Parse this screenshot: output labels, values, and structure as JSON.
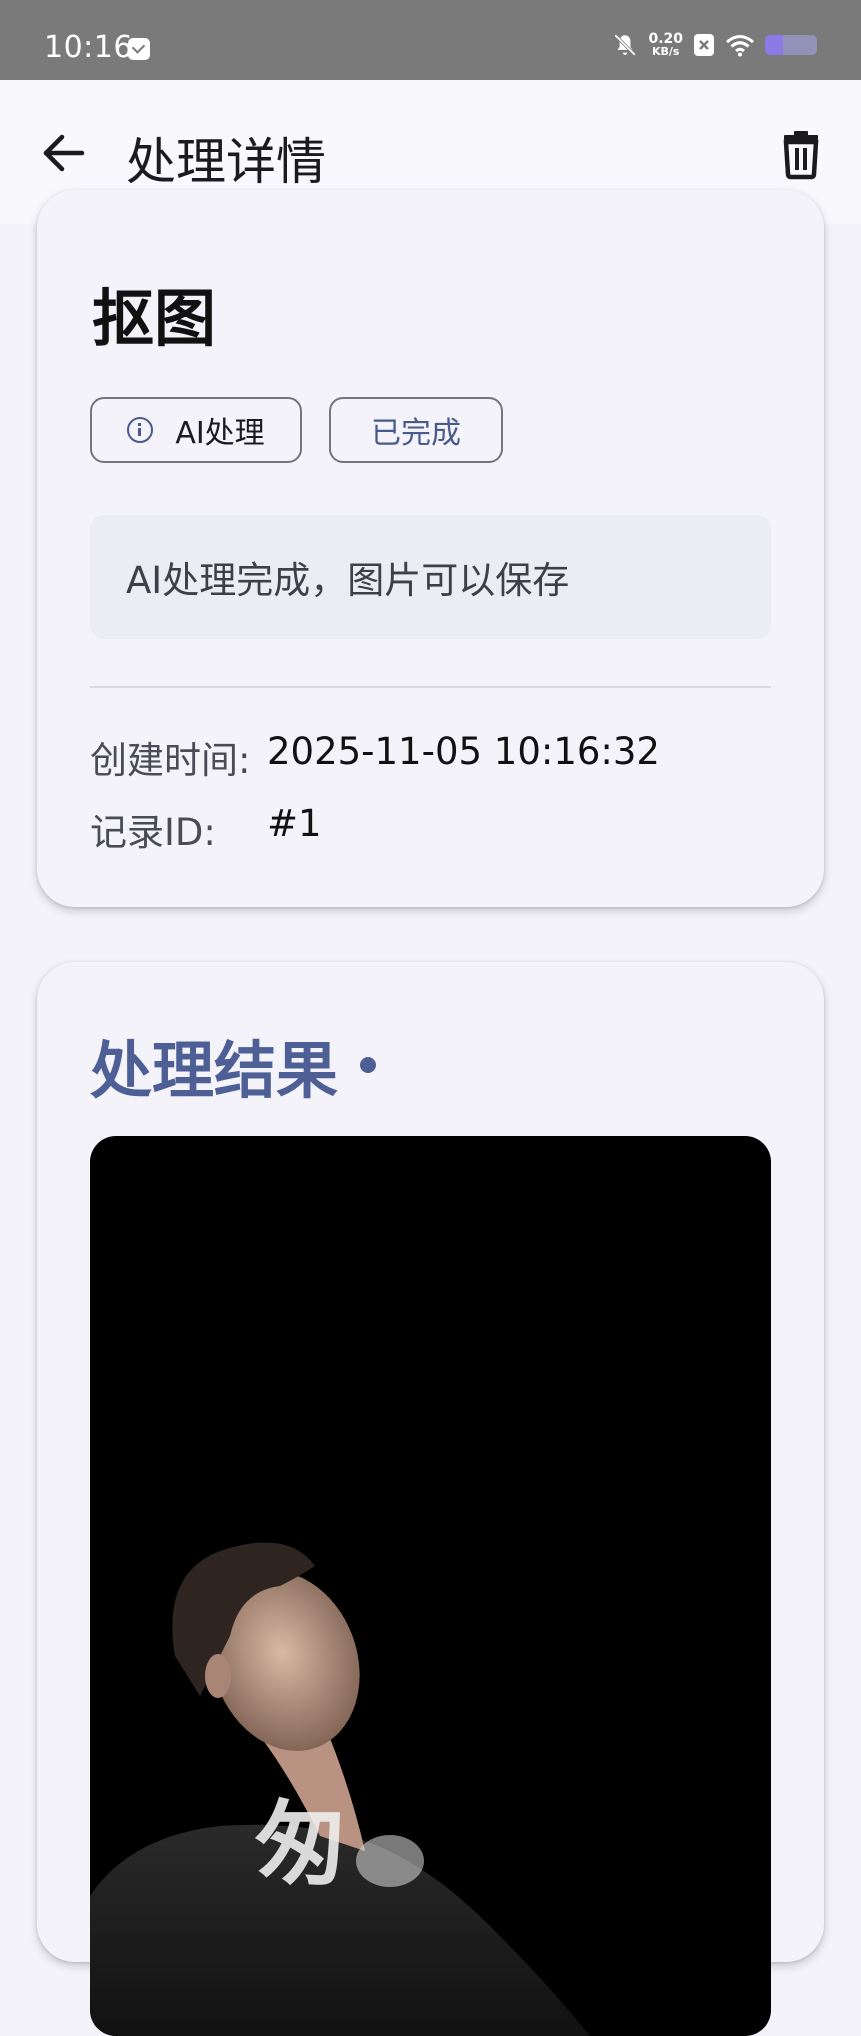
{
  "status_bar": {
    "time": "10:16",
    "net_speed_value": "0.20",
    "net_speed_unit": "KB/s",
    "battery_level": 0.35
  },
  "app_bar": {
    "title": "处理详情",
    "back_icon": "arrow-back-icon",
    "delete_icon": "trash-icon"
  },
  "record": {
    "type_title": "抠图",
    "chips": {
      "type": "AI处理",
      "status": "已完成"
    },
    "message": "AI处理完成，图片可以保存",
    "created_label": "创建时间:",
    "created_value": "2025-11-05 10:16:32",
    "id_label": "记录ID:",
    "id_value": "#1"
  },
  "result": {
    "title": "处理结果",
    "image_overlay_text": "匆"
  },
  "colors": {
    "accent": "#4d5f95",
    "background": "#f4f3fa",
    "status_bar": "#7a7a7a"
  }
}
